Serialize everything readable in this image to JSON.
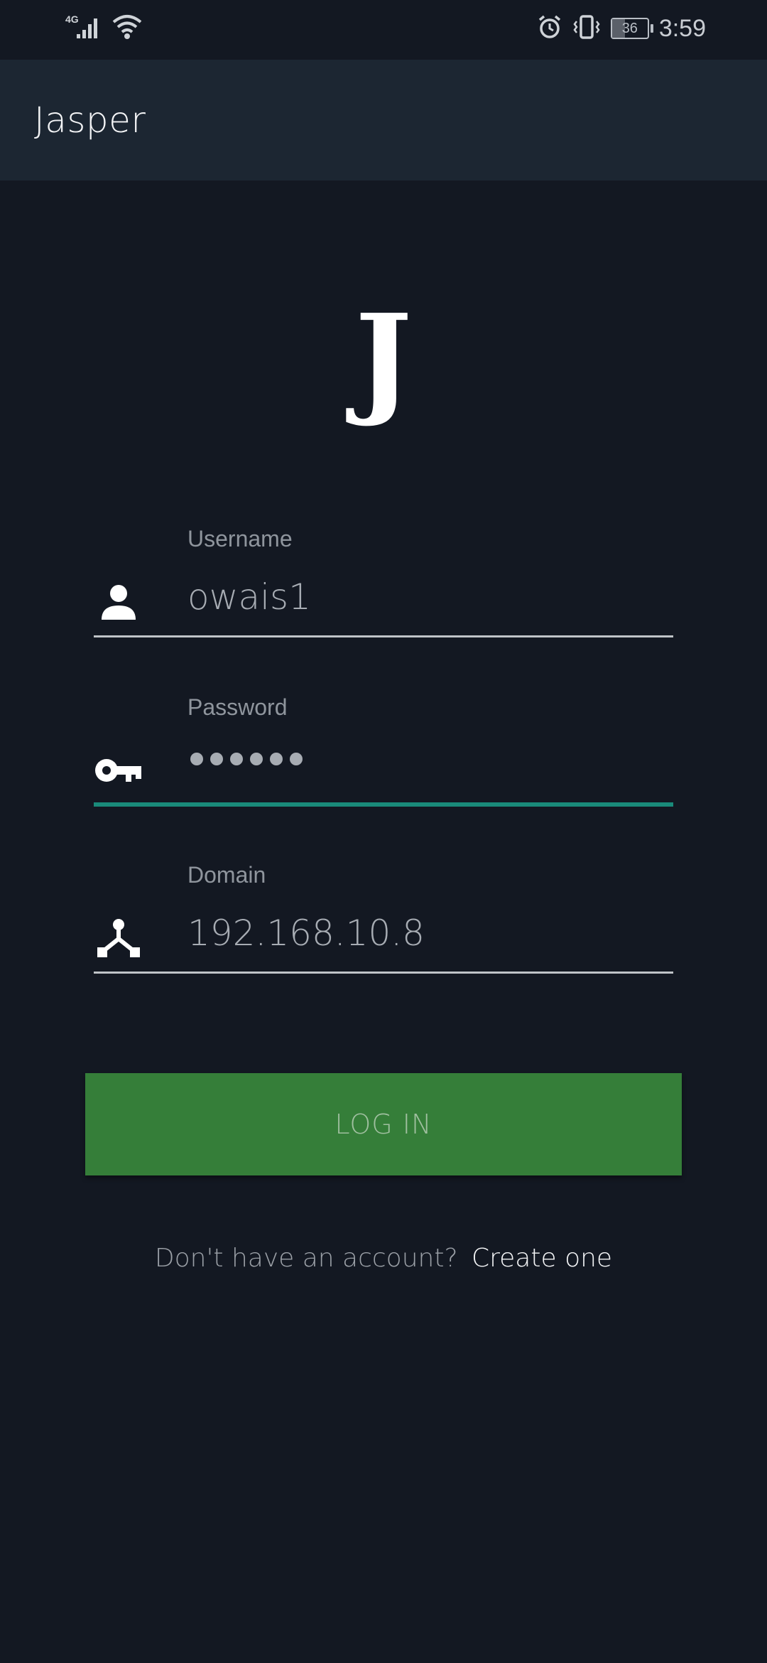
{
  "status_bar": {
    "network_type": "4G",
    "battery_level": "36",
    "time": "3:59",
    "icons": [
      "signal-icon",
      "wifi-icon",
      "alarm-icon",
      "vibrate-icon",
      "battery-icon"
    ]
  },
  "app_bar": {
    "title": "Jasper"
  },
  "logo": {
    "letter": "J"
  },
  "form": {
    "username": {
      "label": "Username",
      "value": "owais1",
      "icon": "person-icon"
    },
    "password": {
      "label": "Password",
      "masked_length": 6,
      "icon": "key-icon"
    },
    "domain": {
      "label": "Domain",
      "value": "192.168.10.8",
      "icon": "network-icon"
    }
  },
  "login_button": {
    "label": "LOG IN"
  },
  "signup": {
    "prompt": "Don't have an account?",
    "link": "Create one"
  },
  "colors": {
    "background": "#131822",
    "app_bar": "#1c2632",
    "accent": "#1a8a7a",
    "button": "#357e39"
  }
}
